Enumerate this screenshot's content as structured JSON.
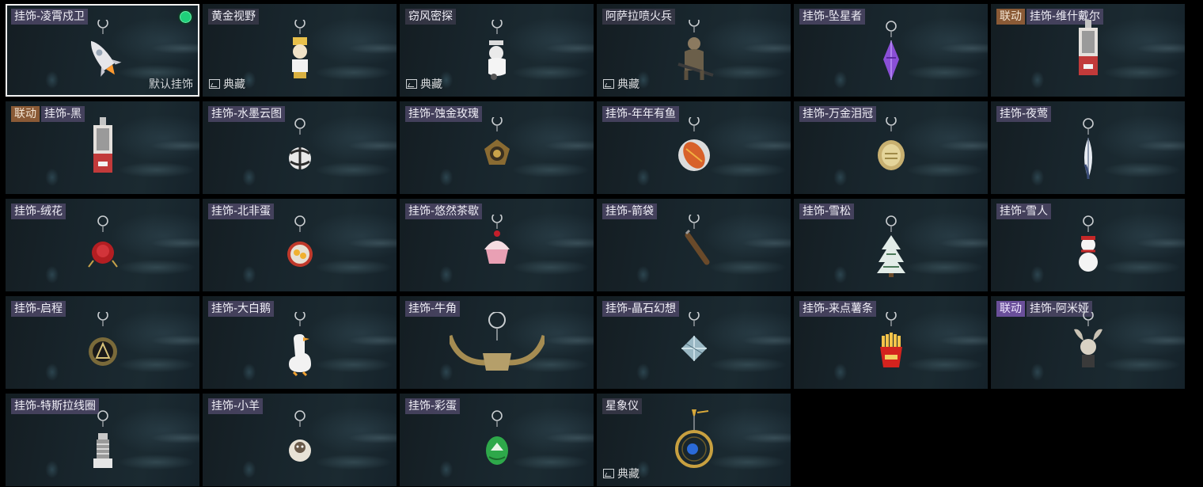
{
  "ui": {
    "equipped_dot_color": "#1fd07a",
    "collab_tag_color": "#8a5a36",
    "collab_tag_color_alt": "#6a4f9a",
    "name_tag_color": "#4e4868",
    "selected_border_color": "#f2f2f2"
  },
  "items": [
    {
      "name": "挂饰-凌霄戍卫",
      "icon": "rocket-charm-icon",
      "selected": true,
      "equipped": true,
      "footer": "默认挂饰"
    },
    {
      "name": "黄金视野",
      "icon": "gold-figure-charm-icon",
      "collection": "典藏"
    },
    {
      "name": "窃风密探",
      "icon": "white-figure-charm-icon",
      "collection": "典藏"
    },
    {
      "name": "阿萨拉喷火兵",
      "icon": "soldier-charm-icon",
      "collection": "典藏"
    },
    {
      "name": "挂饰-坠星者",
      "icon": "purple-crystal-charm-icon"
    },
    {
      "name": "挂饰-维什戴尔",
      "icon": "card-charm-icon",
      "tag": "联动"
    },
    {
      "name": "挂饰-黑",
      "icon": "card-charm-icon",
      "tag": "联动"
    },
    {
      "name": "挂饰-水墨云图",
      "icon": "ink-ball-charm-icon"
    },
    {
      "name": "挂饰-蚀金玫瑰",
      "icon": "gold-rose-emblem-charm-icon"
    },
    {
      "name": "挂饰-年年有鱼",
      "icon": "fish-charm-icon"
    },
    {
      "name": "挂饰-万金泪冠",
      "icon": "gold-coin-charm-icon"
    },
    {
      "name": "挂饰-夜莺",
      "icon": "feather-charm-icon"
    },
    {
      "name": "挂饰-绒花",
      "icon": "red-rose-charm-icon"
    },
    {
      "name": "挂饰-北非蛋",
      "icon": "egg-pan-charm-icon"
    },
    {
      "name": "挂饰-悠然茶歇",
      "icon": "cupcake-charm-icon"
    },
    {
      "name": "挂饰-箭袋",
      "icon": "quiver-charm-icon"
    },
    {
      "name": "挂饰-雪松",
      "icon": "snow-tree-charm-icon"
    },
    {
      "name": "挂饰-雪人",
      "icon": "snowman-charm-icon"
    },
    {
      "name": "挂饰-启程",
      "icon": "compass-medal-charm-icon"
    },
    {
      "name": "挂饰-大白鹅",
      "icon": "goose-charm-icon"
    },
    {
      "name": "挂饰-牛角",
      "icon": "horns-charm-icon"
    },
    {
      "name": "挂饰-晶石幻想",
      "icon": "crystal-cube-charm-icon"
    },
    {
      "name": "挂饰-来点薯条",
      "icon": "fries-charm-icon"
    },
    {
      "name": "挂饰-阿米娅",
      "icon": "bunny-charm-icon",
      "tag": "联动",
      "tag_style": "purple"
    },
    {
      "name": "挂饰-特斯拉线圈",
      "icon": "tesla-coil-charm-icon"
    },
    {
      "name": "挂饰-小羊",
      "icon": "sheep-charm-icon"
    },
    {
      "name": "挂饰-彩蛋",
      "icon": "green-egg-charm-icon"
    },
    {
      "name": "星象仪",
      "icon": "astrolabe-charm-icon",
      "collection": "典藏"
    }
  ]
}
